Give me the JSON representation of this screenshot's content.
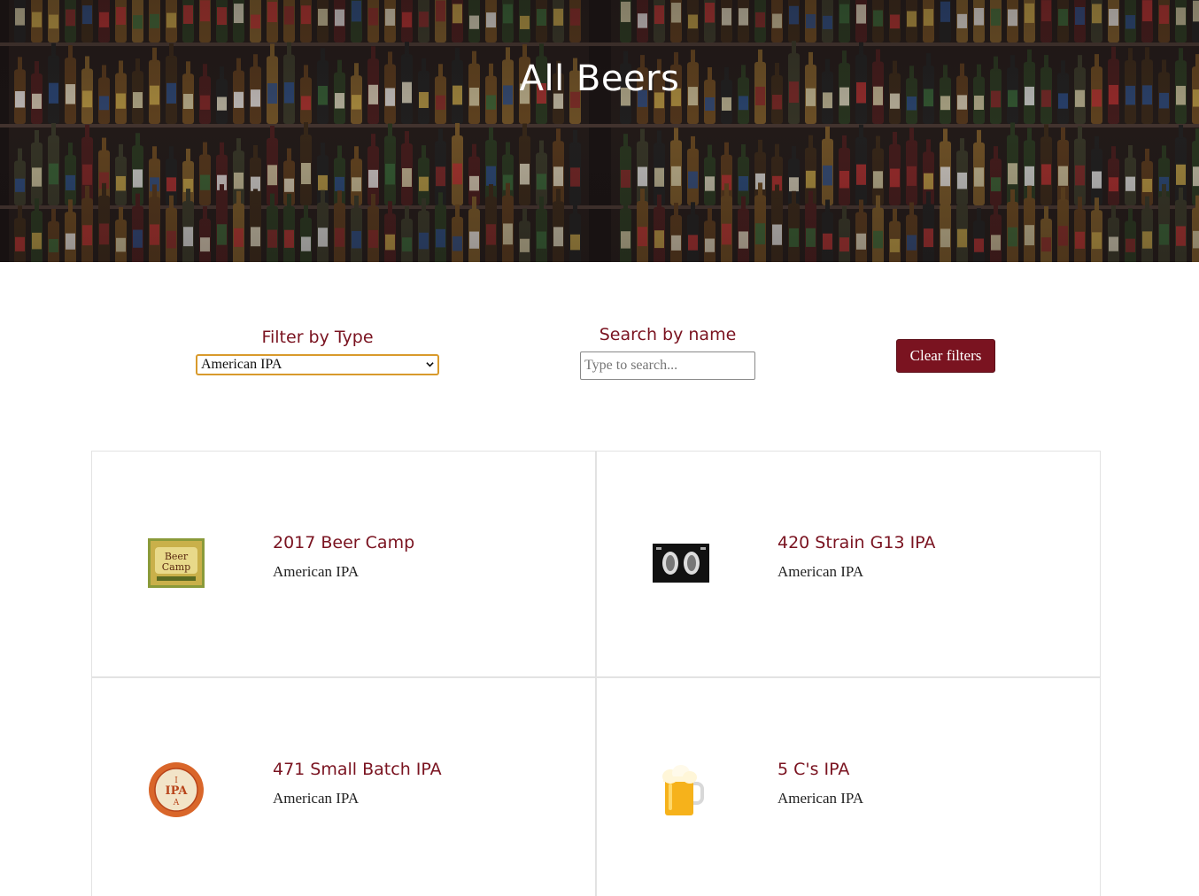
{
  "hero": {
    "title": "All Beers"
  },
  "filters": {
    "type_label": "Filter by Type",
    "type_selected": "American IPA",
    "search_label": "Search by name",
    "search_placeholder": "Type to search...",
    "search_value": "",
    "clear_label": "Clear filters"
  },
  "colors": {
    "accent": "#7a1320",
    "select_border": "#d89a2c",
    "hero_bg": "#1a1414"
  },
  "beers": [
    {
      "name": "2017 Beer Camp",
      "type": "American IPA",
      "thumb": "beer-camp-label"
    },
    {
      "name": "420 Strain G13 IPA",
      "type": "American IPA",
      "thumb": "420-strain-label"
    },
    {
      "name": "471 Small Batch IPA",
      "type": "American IPA",
      "thumb": "ipa-round-badge"
    },
    {
      "name": "5 C's IPA",
      "type": "American IPA",
      "thumb": "beer-mug-icon"
    }
  ]
}
